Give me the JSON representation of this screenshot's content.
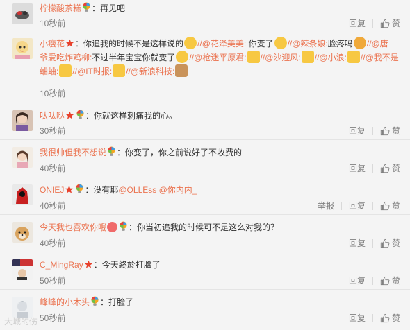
{
  "comments": [
    {
      "username": "柠檬酸茶糕",
      "sep": "：",
      "text": "再见吧",
      "time": "10秒前",
      "reply": "回复",
      "like": "赞"
    },
    {
      "username": "小瘦花",
      "sep": "：",
      "t1": "你追我的时候不是这样说的",
      "at1": "//@花泽美美:",
      "t2": " 你变了",
      "at2": "//@辣条娘:",
      "t3": "脸疼吗",
      "at3": "//@唐",
      "at3b": "爷爱吃炸鸡柳:",
      "t4": "不过半年宝宝你就变了",
      "at4": "//@枪迷平原君:",
      "at5": "//@沙迎风:",
      "at6": "//@小浪:",
      "at7": "//@我不是",
      "at7b": "蛐蛐:",
      "at8": "//@IT时报:",
      "at9": "//@新浪科技:",
      "time": "10秒前",
      "reply": "回复",
      "like": "赞"
    },
    {
      "username": "呔呔哒",
      "sep": "：",
      "text": "你就这样刺痛我的心。",
      "time": "30秒前",
      "reply": "回复",
      "like": "赞"
    },
    {
      "username": "我很帅但我不想说",
      "sep": "：",
      "text": "你变了，你之前说好了不收费的",
      "time": "40秒前",
      "reply": "回复",
      "like": "赞"
    },
    {
      "username": "ONIEJ",
      "sep": "：",
      "text": "没有耶",
      "at1": "@OLLEss",
      "at2": "@你内内_",
      "time": "40秒前",
      "report": "举报",
      "reply": "回复",
      "like": "赞"
    },
    {
      "username": "今天我也喜欢你哦",
      "sep": "：",
      "text": "你当初追我的时候可不是这么对我的？",
      "time": "40秒前",
      "reply": "回复",
      "like": "赞"
    },
    {
      "username": "C_MingRay",
      "sep": "：",
      "text": "今天終於打臉了",
      "time": "50秒前",
      "reply": "回复",
      "like": "赞"
    },
    {
      "username": "峰峰的小木头",
      "sep": "：",
      "text": "打脸了",
      "time": "50秒前",
      "reply": "回复",
      "like": "赞"
    }
  ],
  "watermark": "大城的伤",
  "colors": {
    "link": "#eb7350",
    "meta": "#808080",
    "bg": "#f4f4f4"
  }
}
